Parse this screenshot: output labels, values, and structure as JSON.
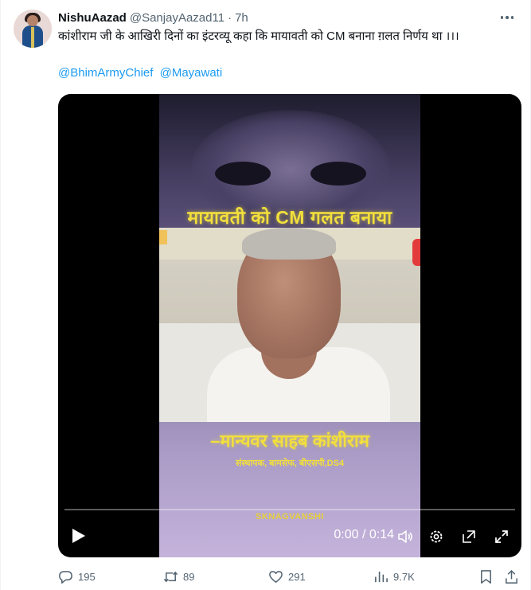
{
  "tweet": {
    "author": {
      "display_name": "NishuAazad",
      "handle": "@SanjayAazad11",
      "separator": "·",
      "time": "7h"
    },
    "text": "कांशीराम जी के आखिरी दिनों का इंटरव्यू कहा कि मायावती को CM बनाना ग़लत निर्णय था ।।।",
    "mentions": [
      "@BhimArmyChief",
      "@Mayawati"
    ],
    "icons": {
      "more": "more-horizontal-icon",
      "reply": "reply-icon",
      "retweet": "retweet-icon",
      "like": "like-icon",
      "views": "views-icon",
      "bookmark": "bookmark-icon",
      "share": "share-icon"
    },
    "stats": {
      "replies": "195",
      "retweets": "89",
      "likes": "291",
      "views": "9.7K"
    }
  },
  "video": {
    "headline": "मायावती को CM गलत बनाया",
    "caption": "–मान्यवर साहब कांशीराम",
    "subcaption": "संस्थापक, बामसेफ, बीएसपी,DS4",
    "watermark": "SKNAGVANSHI",
    "timecode": "0:00 / 0:14",
    "progress": 0,
    "icons": {
      "play": "play-icon",
      "volume": "volume-icon",
      "settings": "settings-icon",
      "popout": "popout-icon",
      "fullscreen": "fullscreen-icon"
    }
  },
  "colors": {
    "accent": "#1d9bf0",
    "text": "#0f1419",
    "muted": "#536471",
    "caption_yellow": "#f2df3c"
  }
}
